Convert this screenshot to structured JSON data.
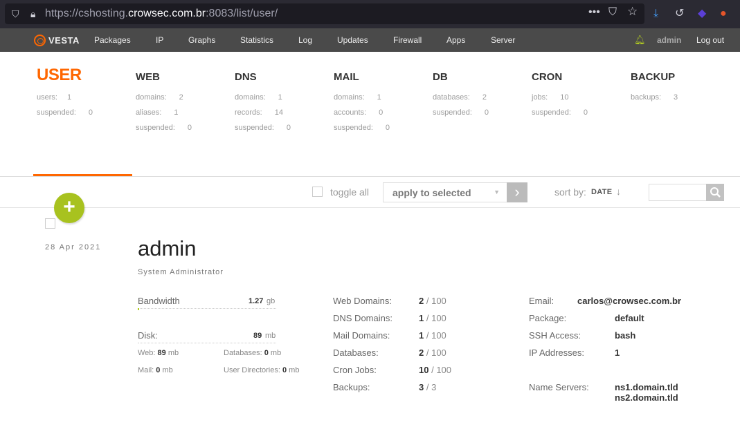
{
  "browser": {
    "url_prefix": "https://cshosting.",
    "url_host": "crowsec.com.br",
    "url_suffix": ":8083/list/user/"
  },
  "nav": {
    "logo_text": "VESTA",
    "items": [
      "Packages",
      "IP",
      "Graphs",
      "Statistics",
      "Log",
      "Updates",
      "Firewall",
      "Apps",
      "Server"
    ],
    "user": "admin",
    "logout": "Log out"
  },
  "tabs": [
    {
      "title": "USER",
      "rows": [
        {
          "k": "users:",
          "v": "1"
        },
        {
          "k": "suspended:",
          "v": "0"
        }
      ]
    },
    {
      "title": "WEB",
      "rows": [
        {
          "k": "domains:",
          "v": "2"
        },
        {
          "k": "aliases:",
          "v": "1"
        },
        {
          "k": "suspended:",
          "v": "0"
        }
      ]
    },
    {
      "title": "DNS",
      "rows": [
        {
          "k": "domains:",
          "v": "1"
        },
        {
          "k": "records:",
          "v": "14"
        },
        {
          "k": "suspended:",
          "v": "0"
        }
      ]
    },
    {
      "title": "MAIL",
      "rows": [
        {
          "k": "domains:",
          "v": "1"
        },
        {
          "k": "accounts:",
          "v": "0"
        },
        {
          "k": "suspended:",
          "v": "0"
        }
      ]
    },
    {
      "title": "DB",
      "rows": [
        {
          "k": "databases:",
          "v": "2"
        },
        {
          "k": "suspended:",
          "v": "0"
        }
      ]
    },
    {
      "title": "CRON",
      "rows": [
        {
          "k": "jobs:",
          "v": "10"
        },
        {
          "k": "suspended:",
          "v": "0"
        }
      ]
    },
    {
      "title": "BACKUP",
      "rows": [
        {
          "k": "backups:",
          "v": "3"
        }
      ]
    }
  ],
  "toolbar": {
    "toggle_all": "toggle all",
    "apply_placeholder": "apply to selected",
    "sort_by": "sort by:",
    "sort_value": "DATE",
    "sort_arrow": "↓"
  },
  "user": {
    "date": "28  Apr  2021",
    "name": "admin",
    "role": "System Administrator",
    "bandwidth_label": "Bandwidth",
    "bandwidth_value": "1.27",
    "bandwidth_unit": "gb",
    "bandwidth_fraction": 0.01,
    "disk_label": "Disk:",
    "disk_value": "89",
    "disk_unit": "mb",
    "web_label": "Web:",
    "web_value": "89",
    "web_unit": "mb",
    "databases_label": "Databases:",
    "databases_value": "0",
    "databases_unit": "mb",
    "mail_label": "Mail:",
    "mail_value": "0",
    "mail_unit": "mb",
    "userdirs_label": "User Directories:",
    "userdirs_value": "0",
    "userdirs_unit": "mb",
    "limits": [
      {
        "label": "Web Domains:",
        "used": "2",
        "max": "/ 100"
      },
      {
        "label": "DNS Domains:",
        "used": "1",
        "max": "/ 100"
      },
      {
        "label": "Mail Domains:",
        "used": "1",
        "max": "/ 100"
      },
      {
        "label": "Databases:",
        "used": "2",
        "max": "/ 100"
      },
      {
        "label": "Cron Jobs:",
        "used": "10",
        "max": "/ 100"
      },
      {
        "label": "Backups:",
        "used": "3",
        "max": "/ 3"
      }
    ],
    "email_label": "Email:",
    "email": "carlos@crowsec.com.br",
    "package_label": "Package:",
    "package": "default",
    "ssh_label": "SSH Access:",
    "ssh": "bash",
    "ip_label": "IP Addresses:",
    "ip": "1",
    "ns_label": "Name Servers:",
    "ns1": "ns1.domain.tld",
    "ns2": "ns2.domain.tld"
  }
}
